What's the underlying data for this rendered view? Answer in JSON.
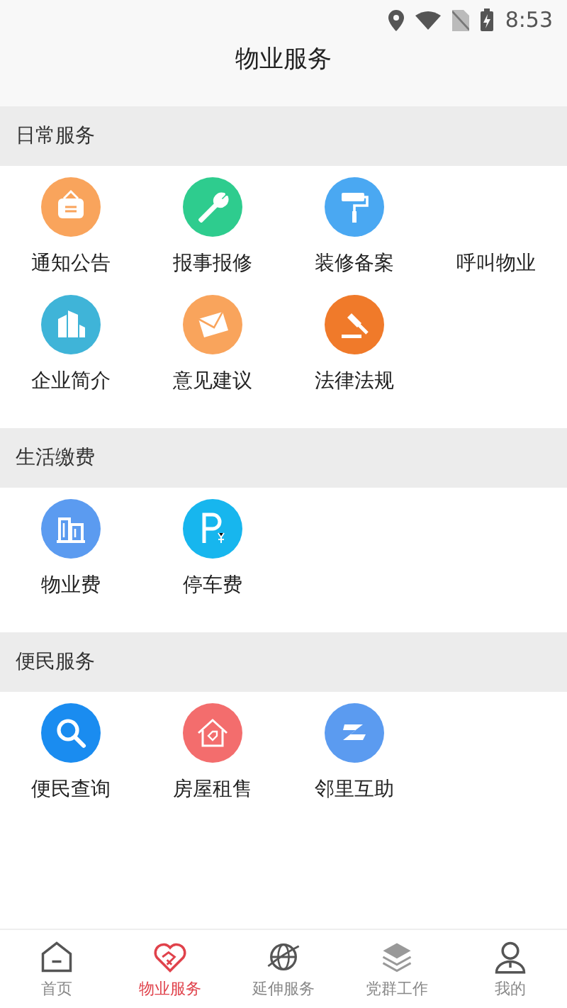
{
  "status_bar": {
    "time": "8:53"
  },
  "title": "物业服务",
  "sections": [
    {
      "title": "日常服务",
      "items": [
        {
          "label": "通知公告",
          "kind": "notice",
          "color": "#f9a45c"
        },
        {
          "label": "报事报修",
          "kind": "wrench",
          "color": "#2ecc8e"
        },
        {
          "label": "装修备案",
          "kind": "roller",
          "color": "#4aa8f2"
        },
        {
          "label": "呼叫物业",
          "kind": "blank"
        },
        {
          "label": "企业简介",
          "kind": "building",
          "color": "#3fb4d8"
        },
        {
          "label": "意见建议",
          "kind": "envelope",
          "color": "#f9a45c"
        },
        {
          "label": "法律法规",
          "kind": "gavel",
          "color": "#f07a2a"
        }
      ]
    },
    {
      "title": "生活缴费",
      "items": [
        {
          "label": "物业费",
          "kind": "bank",
          "color": "#5b9bf0"
        },
        {
          "label": "停车费",
          "kind": "parking",
          "color": "#17b6ee"
        }
      ]
    },
    {
      "title": "便民服务",
      "items": [
        {
          "label": "便民查询",
          "kind": "search",
          "color": "#1a8cf0"
        },
        {
          "label": "房屋租售",
          "kind": "house",
          "color": "#f36d6d"
        },
        {
          "label": "邻里互助",
          "kind": "zigzag",
          "color": "#5b9bf0"
        }
      ]
    }
  ],
  "tabs": [
    {
      "label": "首页",
      "kind": "home",
      "selected": false
    },
    {
      "label": "物业服务",
      "kind": "heart",
      "selected": true
    },
    {
      "label": "延伸服务",
      "kind": "globe",
      "selected": false
    },
    {
      "label": "党群工作",
      "kind": "layers",
      "selected": false
    },
    {
      "label": "我的",
      "kind": "person",
      "selected": false
    }
  ]
}
